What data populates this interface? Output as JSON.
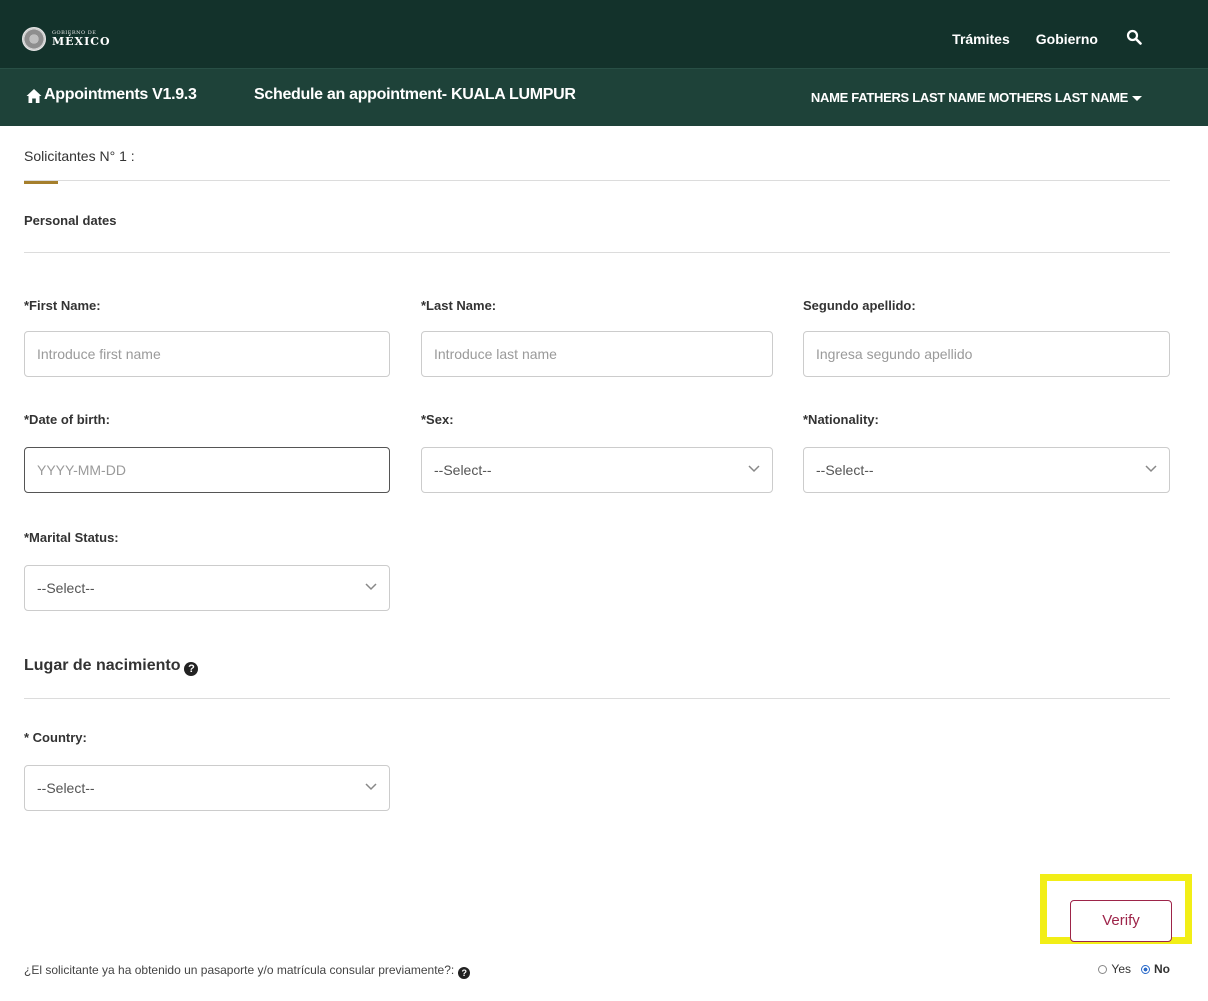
{
  "gov_header": {
    "logo_small": "GOBIERNO DE",
    "logo_big": "MÉXICO",
    "links": [
      "Trámites",
      "Gobierno"
    ]
  },
  "app_bar": {
    "title": "Appointments V1.9.3",
    "subtitle": "Schedule an appointment- KUALA LUMPUR",
    "user_name": "NAME FATHERS LAST NAME MOTHERS LAST NAME"
  },
  "form": {
    "section_title": "Solicitantes N° 1 :",
    "personal_heading": "Personal dates",
    "first_name": {
      "label": "*First Name:",
      "placeholder": "Introduce first name"
    },
    "last_name": {
      "label": "*Last Name:",
      "placeholder": "Introduce last name"
    },
    "second_surname": {
      "label": "Segundo apellido:",
      "placeholder": "Ingresa segundo apellido"
    },
    "dob": {
      "label": "*Date of birth:",
      "placeholder": "YYYY-MM-DD"
    },
    "sex": {
      "label": "*Sex:",
      "value": "--Select--"
    },
    "nationality": {
      "label": "*Nationality:",
      "value": "--Select--"
    },
    "marital": {
      "label": "*Marital Status:",
      "value": "--Select--"
    },
    "birthplace_heading": "Lugar de nacimiento",
    "country": {
      "label": "* Country:",
      "value": "--Select--"
    },
    "verify_label": "Verify",
    "passport_question": "¿El solicitante ya ha obtenido un pasaporte y/o matrícula consular previamente?:",
    "radio_yes": "Yes",
    "radio_no": "No",
    "radio_selected": "No"
  },
  "colors": {
    "gov_green": "#13322b",
    "app_green": "#1e4239",
    "accent_gold": "#a57f2c",
    "button_maroon": "#9d2449",
    "highlight_yellow": "#f2ee16"
  }
}
